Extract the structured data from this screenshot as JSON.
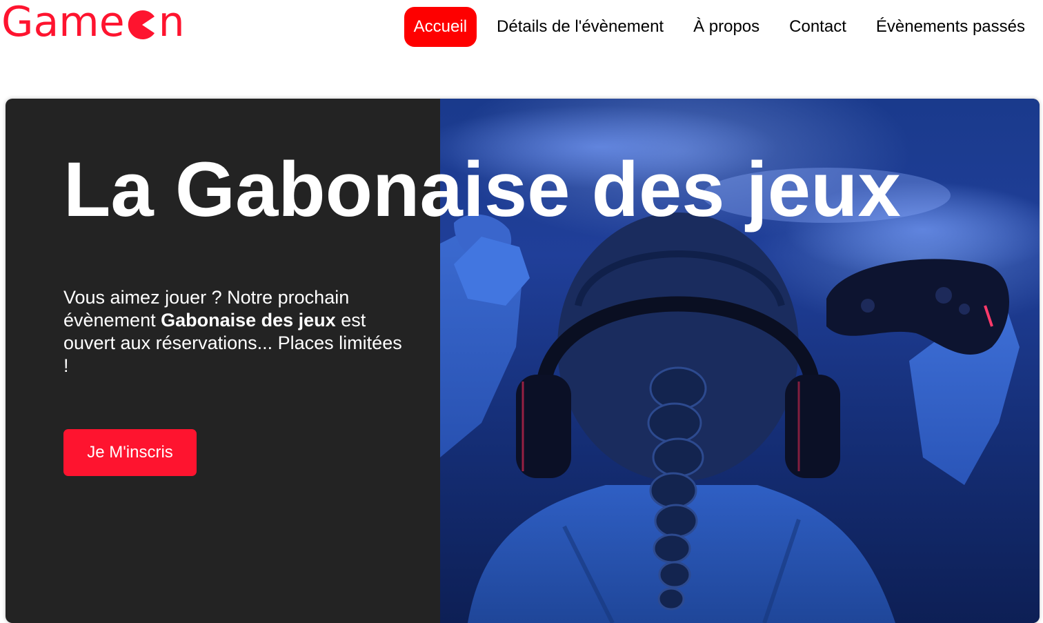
{
  "header": {
    "logo": {
      "prefix": "Game",
      "suffix": "n",
      "icon": "pacman-o-icon",
      "color": "#fe142f"
    },
    "nav": [
      {
        "label": "Accueil",
        "active": true
      },
      {
        "label": "Détails de l'évènement",
        "active": false
      },
      {
        "label": "À propos",
        "active": false
      },
      {
        "label": "Contact",
        "active": false
      },
      {
        "label": "Évènements passés",
        "active": false
      }
    ],
    "active_color": "#fe0000"
  },
  "hero": {
    "title": "La Gabonaise des jeux",
    "text_before": "Vous aimez jouer ? Notre prochain évènement ",
    "text_bold": "Gabonaise des jeux",
    "text_after": " est ouvert aux réservations... Places limitées !",
    "cta_label": "Je M'inscris",
    "cta_color": "#fe142f",
    "panel_color": "#232323",
    "image": "gamer-girl-headphones-controller-photo"
  }
}
